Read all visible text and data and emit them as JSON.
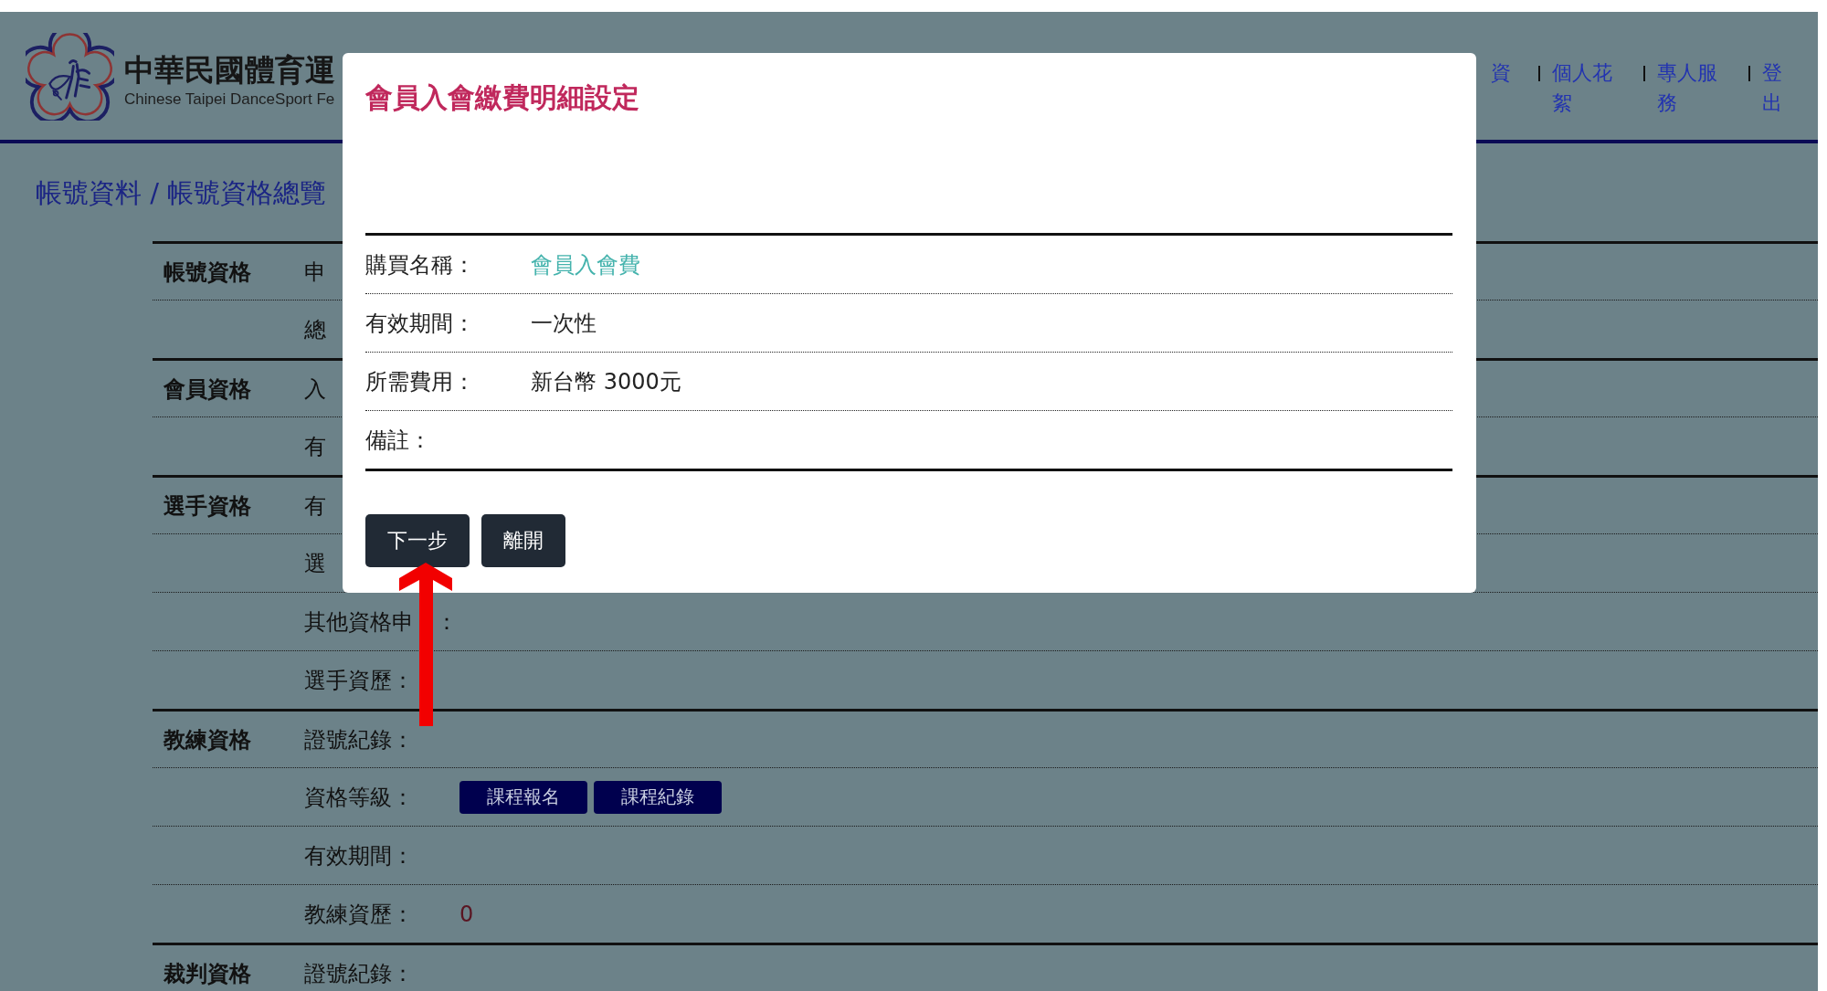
{
  "header": {
    "logo_title": "中華民國體育運",
    "logo_subtitle": "Chinese Taipei DanceSport Fe",
    "nav": [
      "資",
      "個人花絮",
      "專人服務",
      "登出"
    ]
  },
  "page_title": "帳號資料 / 帳號資格總覽",
  "sections": [
    {
      "heading": "帳號資格",
      "rows": [
        {
          "label": "申"
        },
        {
          "label": "總"
        }
      ]
    },
    {
      "heading": "會員資格",
      "rows": [
        {
          "label": "入"
        },
        {
          "label": "有"
        }
      ]
    },
    {
      "heading": "選手資格",
      "rows": [
        {
          "label": "有"
        },
        {
          "label": "選"
        },
        {
          "label": "其他資格申",
          "label_tail": "："
        },
        {
          "label": "選手資歷："
        }
      ]
    },
    {
      "heading": "教練資格",
      "rows": [
        {
          "label": "證號紀錄："
        },
        {
          "label": "資格等級：",
          "buttons": [
            "課程報名",
            "課程紀錄"
          ]
        },
        {
          "label": "有效期間："
        },
        {
          "label": "教練資歷：",
          "value": "0"
        }
      ]
    },
    {
      "heading": "裁判資格",
      "rows": [
        {
          "label": "證號紀錄："
        }
      ]
    }
  ],
  "modal": {
    "title": "會員入會繳費明細設定",
    "fields": [
      {
        "label": "購買名稱：",
        "value": "會員入會費",
        "kind": "highlight"
      },
      {
        "label": "有效期間：",
        "value": "一次性",
        "kind": "plain"
      },
      {
        "label": "所需費用：",
        "value": "新台幣 3000元",
        "kind": "plain"
      },
      {
        "label": "備註："
      }
    ],
    "buttons": [
      "下一步",
      "離開"
    ]
  }
}
